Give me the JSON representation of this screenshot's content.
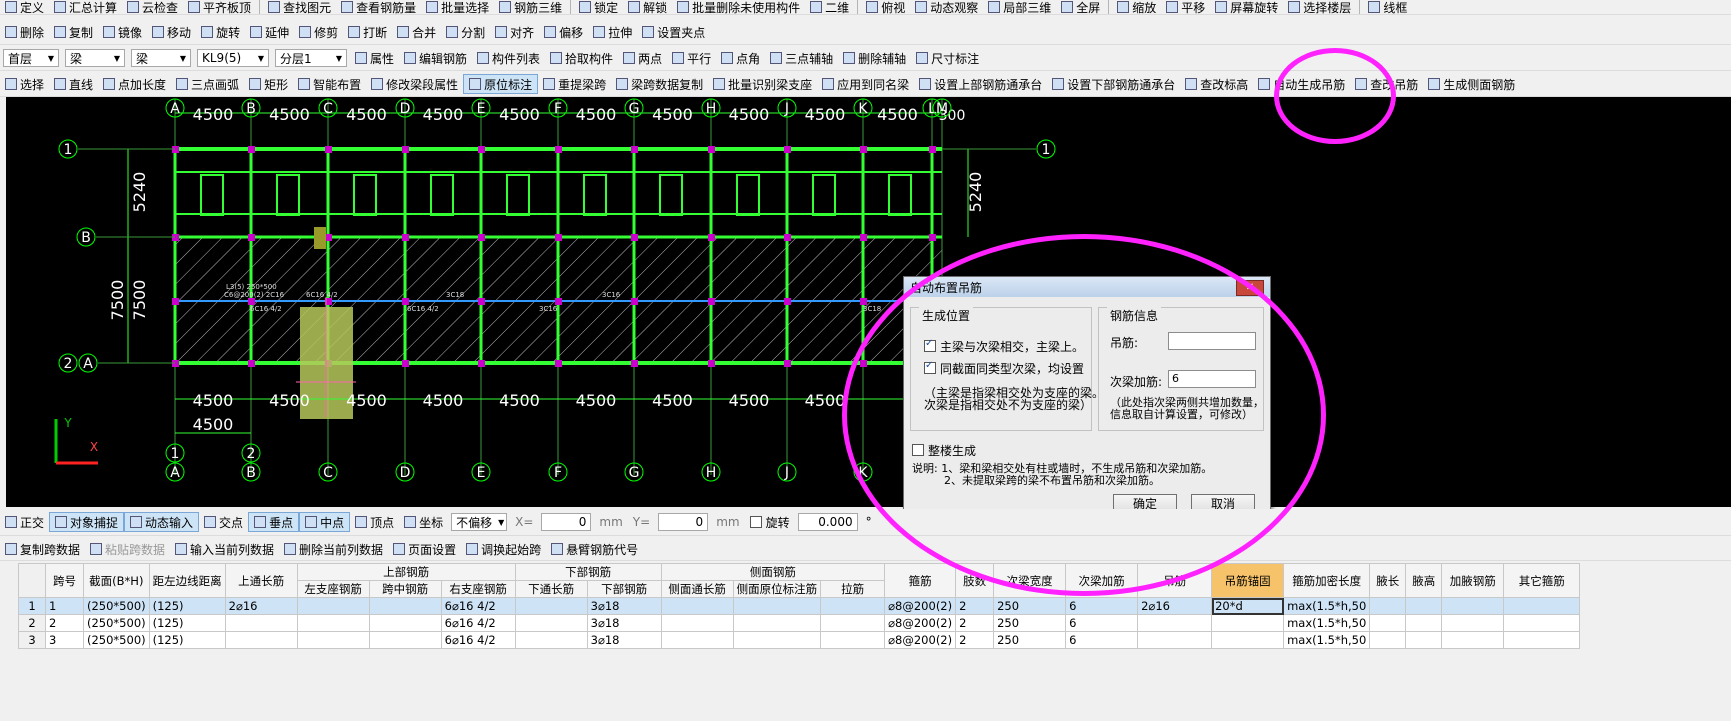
{
  "toolbar1": [
    "定义",
    "汇总计算",
    "云检查",
    "平齐板顶",
    "查找图元",
    "查看钢筋量",
    "批量选择",
    "钢筋三维",
    "锁定",
    "解锁",
    "批量删除未使用构件",
    "二维",
    "俯视",
    "动态观察",
    "局部三维",
    "全屏",
    "缩放",
    "平移",
    "屏幕旋转",
    "选择楼层",
    "线框"
  ],
  "toolbar2": [
    "删除",
    "复制",
    "镜像",
    "移动",
    "旋转",
    "延伸",
    "修剪",
    "打断",
    "合并",
    "分割",
    "对齐",
    "偏移",
    "拉伸",
    "设置夹点"
  ],
  "toolbar3": {
    "floor": "首层",
    "type": "梁",
    "subtype": "梁",
    "name": "KL9(5)",
    "layer": "分层1",
    "items": [
      "属性",
      "编辑钢筋",
      "构件列表",
      "拾取构件",
      "两点",
      "平行",
      "点角",
      "三点辅轴",
      "删除辅轴",
      "尺寸标注"
    ]
  },
  "toolbar4": [
    "选择",
    "直线",
    "点加长度",
    "三点画弧",
    "矩形",
    "智能布置",
    "修改梁段属性",
    "原位标注",
    "重提梁跨",
    "梁跨数据复制",
    "批量识别梁支座",
    "应用到同名梁",
    "设置上部钢筋通承台",
    "设置下部钢筋通承台",
    "查改标高",
    "自动生成吊筋",
    "查改吊筋",
    "生成侧面钢筋"
  ],
  "canvas": {
    "axes_top": [
      "A",
      "B",
      "C",
      "D",
      "E",
      "F",
      "G",
      "H",
      "J",
      "K",
      "L",
      "M"
    ],
    "axes_bottom": [
      "A",
      "B",
      "C",
      "D",
      "E",
      "F",
      "G",
      "H",
      "J",
      "K"
    ],
    "spacing_top": [
      "4500",
      "4500",
      "4500",
      "4500",
      "4500",
      "4500",
      "4500",
      "4500",
      "4500",
      "4500",
      "300"
    ],
    "spacing_bottom": [
      "4500",
      "4500",
      "4500",
      "4500",
      "4500",
      "4500",
      "4500",
      "4500",
      "4500"
    ],
    "spacing_bottom2": "4500",
    "left_dims": [
      "5240",
      "7500"
    ],
    "right_dim": "5240",
    "row_labels": [
      "1",
      "B",
      "2",
      "A",
      "1",
      "2"
    ],
    "beam_annotations": [
      "L3(5) 250*500",
      "C6@200(2) 2C16",
      "6C16 4/2",
      "3C18",
      "6C16 4/2",
      "3C16",
      "6C16 4/2",
      "3C16",
      "3C18"
    ],
    "axis_y": "Y",
    "axis_x": "X"
  },
  "dialog": {
    "title": "自动布置吊筋",
    "close": "✕",
    "pos_group": "生成位置",
    "opt1": "主梁与次梁相交，主梁上。",
    "opt2": "同截面同类型次梁，均设置",
    "note1": "（主梁是指梁相交处为支座的梁。",
    "note2": "次梁是指相交处不为支座的梁）",
    "rebar_group": "钢筋信息",
    "hanger_label": "吊筋:",
    "hanger_value": "",
    "secbeam_label": "次梁加筋:",
    "secbeam_value": "6",
    "note3": "（此处指次梁两侧共增加数量，",
    "note4": "信息取自计算设置，可修改）",
    "whole": "整楼生成",
    "explain1": "说明: 1、梁和梁相交处有柱或墙时，不生成吊筋和次梁加筋。",
    "explain2": "2、未提取梁跨的梁不布置吊筋和次梁加筋。",
    "ok": "确定",
    "cancel": "取消"
  },
  "status": {
    "items": [
      "正交",
      "对象捕捉",
      "动态输入",
      "交点",
      "垂点",
      "中点",
      "顶点",
      "坐标"
    ],
    "offset": "不偏移",
    "x_label": "X=",
    "x_value": "0",
    "mm1": "mm",
    "y_label": "Y=",
    "y_value": "0",
    "mm2": "mm",
    "rotate": "旋转",
    "rotate_value": "0.000",
    "deg": "°"
  },
  "table_toolbar": [
    "复制跨数据",
    "粘贴跨数据",
    "输入当前列数据",
    "删除当前列数据",
    "页面设置",
    "调换起始跨",
    "悬臂钢筋代号"
  ],
  "table": {
    "group_top": [
      "上部钢筋",
      "下部钢筋",
      "侧面钢筋"
    ],
    "headers": [
      "跨号",
      "截面(B*H)",
      "距左边线距离",
      "上通长筋",
      "左支座钢筋",
      "跨中钢筋",
      "右支座钢筋",
      "下通长筋",
      "下部钢筋",
      "侧面通长筋",
      "侧面原位标注筋",
      "拉筋",
      "箍筋",
      "肢数",
      "次梁宽度",
      "次梁加筋",
      "吊筋",
      "吊筋锚固",
      "箍筋加密长度",
      "腋长",
      "腋高",
      "加腋钢筋",
      "其它箍筋"
    ],
    "rows": [
      [
        "1",
        "1",
        "(250*500)",
        "(125)",
        "2⌀16",
        "",
        "",
        "6⌀16 4/2",
        "",
        "3⌀18",
        "",
        "",
        "",
        "⌀8@200(2)",
        "2",
        "250",
        "6",
        "2⌀16",
        "20*d",
        "max(1.5*h,50",
        "",
        "",
        "",
        ""
      ],
      [
        "2",
        "2",
        "(250*500)",
        "(125)",
        "",
        "",
        "",
        "6⌀16 4/2",
        "",
        "3⌀18",
        "",
        "",
        "",
        "⌀8@200(2)",
        "2",
        "250",
        "6",
        "",
        "",
        "max(1.5*h,50",
        "",
        "",
        "",
        ""
      ],
      [
        "3",
        "3",
        "(250*500)",
        "(125)",
        "",
        "",
        "",
        "6⌀16 4/2",
        "",
        "3⌀18",
        "",
        "",
        "",
        "⌀8@200(2)",
        "2",
        "250",
        "6",
        "",
        "",
        "max(1.5*h,50",
        "",
        "",
        "",
        ""
      ]
    ]
  },
  "colors": {
    "beam": "#33ff33",
    "accent": "#ff22ff",
    "axis": "#00ff00",
    "dim": "#ffffff"
  }
}
